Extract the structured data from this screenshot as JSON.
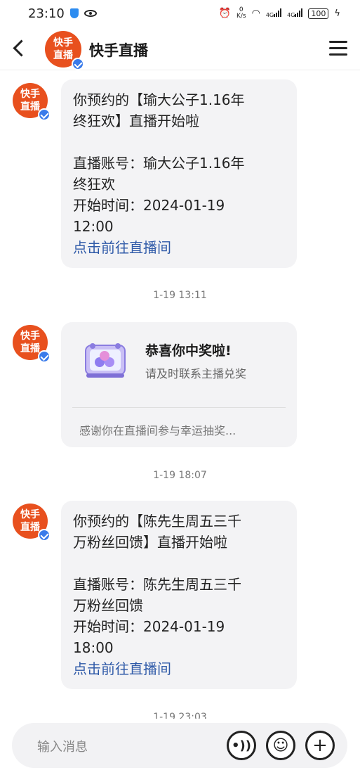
{
  "status_bar": {
    "time": "23:10",
    "net_speed_value": "0",
    "net_speed_unit": "K/s",
    "signal1_label": "4G",
    "signal2_label": "4G",
    "battery": "100"
  },
  "header": {
    "title": "快手直播",
    "avatar_line1": "快手",
    "avatar_line2": "直播"
  },
  "messages": [
    {
      "line1": "你预约的【瑜大公子1.16年",
      "line2": "终狂欢】直播开始啦",
      "account1": "直播账号：瑜大公子1.16年",
      "account2": "终狂欢",
      "time1": "开始时间：2024-01-19",
      "time2": "12:00",
      "link": "点击前往直播间"
    },
    {
      "timestamp": "1-19 13:11",
      "title": "恭喜你中奖啦!",
      "subtitle": "请及时联系主播兑奖",
      "footer": "感谢你在直播间参与幸运抽奖..."
    },
    {
      "timestamp": "1-19 18:07",
      "line1": "你预约的【陈先生周五三千",
      "line2": "万粉丝回馈】直播开始啦",
      "account1": "直播账号：陈先生周五三千",
      "account2": "万粉丝回馈",
      "time1": "开始时间：2024-01-19",
      "time2": "18:00",
      "link": "点击前往直播间"
    }
  ],
  "partial_timestamp": "1-19 23:03",
  "input": {
    "placeholder": "输入消息",
    "voice_icon": "voice-icon",
    "emoji_icon": "emoji-icon",
    "plus_icon": "plus-icon"
  },
  "colors": {
    "avatar": "#e8501e",
    "verified": "#3a7bea",
    "link": "#2f5aa8",
    "bubble": "#f3f3f5"
  }
}
